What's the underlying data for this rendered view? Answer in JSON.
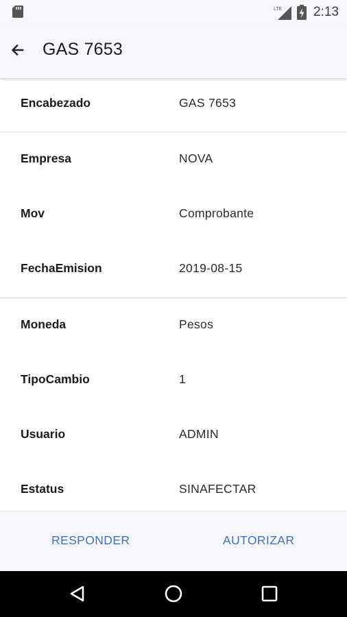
{
  "status_bar": {
    "time": "2:13",
    "network_label": "LTE",
    "icons": [
      "sd-card-icon",
      "lte-signal-icon",
      "battery-charging-icon"
    ]
  },
  "app_bar": {
    "title": "GAS 7653",
    "back_icon": "arrow-back-icon"
  },
  "fields": [
    {
      "label": "Encabezado",
      "value": "GAS 7653"
    },
    {
      "label": "Empresa",
      "value": "NOVA"
    },
    {
      "label": "Mov",
      "value": "Comprobante"
    },
    {
      "label": "FechaEmision",
      "value": "2019-08-15"
    },
    {
      "label": "Moneda",
      "value": "Pesos"
    },
    {
      "label": "TipoCambio",
      "value": "1"
    },
    {
      "label": "Usuario",
      "value": "ADMIN"
    },
    {
      "label": "Estatus",
      "value": "SINAFECTAR"
    }
  ],
  "actions": {
    "responder_label": "RESPONDER",
    "autorizar_label": "AUTORIZAR"
  },
  "nav_bar": {
    "icons": [
      "nav-back-icon",
      "nav-home-icon",
      "nav-recents-icon"
    ]
  },
  "colors": {
    "bar_background": "#f5f7fc",
    "accent": "#3f6fc4",
    "nav_background": "#000000"
  }
}
